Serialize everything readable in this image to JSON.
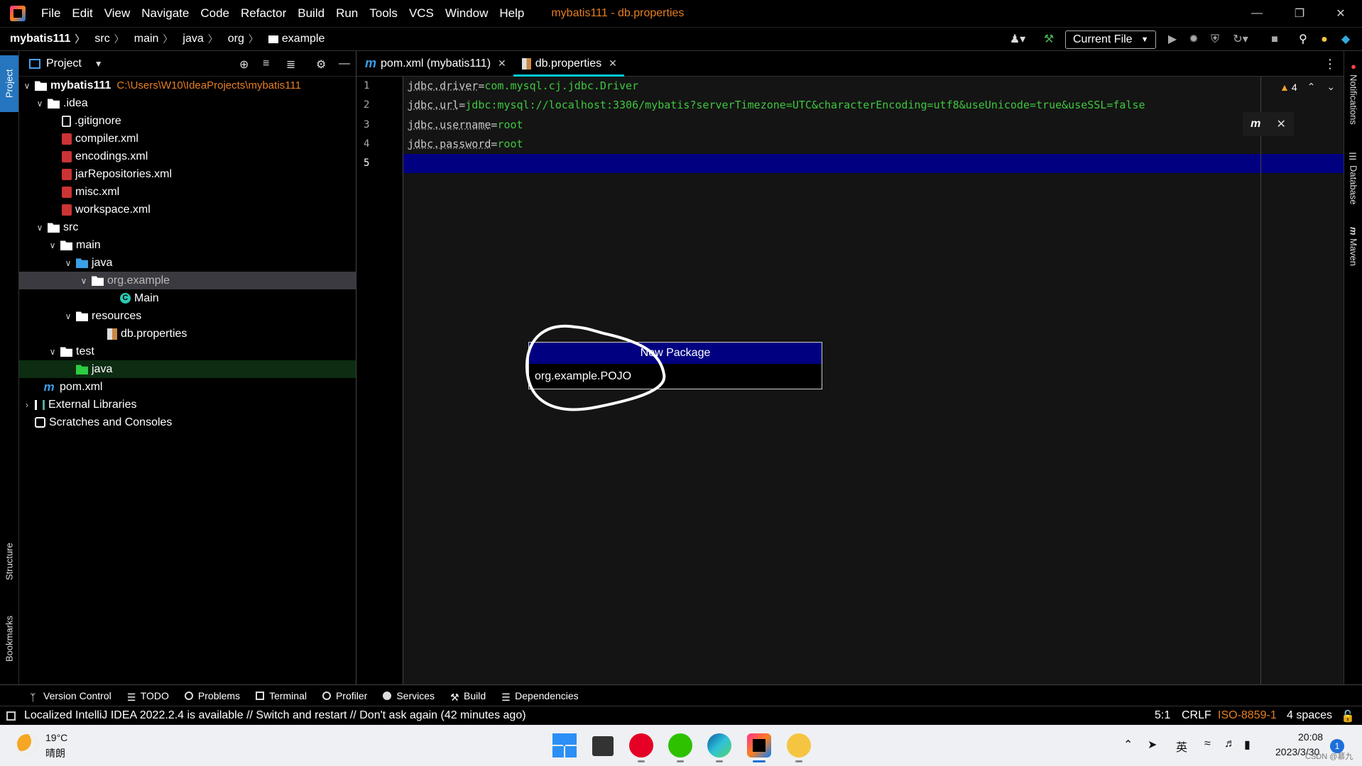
{
  "titlebar": {
    "menu": [
      "File",
      "Edit",
      "View",
      "Navigate",
      "Code",
      "Refactor",
      "Build",
      "Run",
      "Tools",
      "VCS",
      "Window",
      "Help"
    ],
    "window_title": "mybatis111 - db.properties"
  },
  "breadcrumb": [
    "mybatis111",
    "src",
    "main",
    "java",
    "org",
    "example"
  ],
  "run_config": {
    "label": "Current File"
  },
  "project_panel": {
    "title": "Project",
    "tree": [
      {
        "label": "mybatis111",
        "path": "C:\\Users\\W10\\IdeaProjects\\mybatis111"
      },
      {
        "label": ".idea"
      },
      {
        "label": ".gitignore"
      },
      {
        "label": "compiler.xml"
      },
      {
        "label": "encodings.xml"
      },
      {
        "label": "jarRepositories.xml"
      },
      {
        "label": "misc.xml"
      },
      {
        "label": "workspace.xml"
      },
      {
        "label": "src"
      },
      {
        "label": "main"
      },
      {
        "label": "java"
      },
      {
        "label": "org.example"
      },
      {
        "label": "Main"
      },
      {
        "label": "resources"
      },
      {
        "label": "db.properties"
      },
      {
        "label": "test"
      },
      {
        "label": "java"
      },
      {
        "label": "pom.xml"
      },
      {
        "label": "External Libraries"
      },
      {
        "label": "Scratches and Consoles"
      }
    ]
  },
  "left_stripe": {
    "project": "Project",
    "structure": "Structure",
    "bookmarks": "Bookmarks"
  },
  "right_stripe": {
    "notifications": "Notifications",
    "database": "Database",
    "maven": "Maven"
  },
  "editor": {
    "tabs": [
      {
        "label": "pom.xml (mybatis111)"
      },
      {
        "label": "db.properties"
      }
    ],
    "lines": [
      {
        "num": "1",
        "key": "jdbc.driver",
        "value": "com.mysql.cj.jdbc.Driver"
      },
      {
        "num": "2",
        "key": "jdbc.url",
        "value": "jdbc:mysql://localhost:3306/mybatis?serverTimezone=UTC&characterEncoding=utf8&useUnicode=true&useSSL=false"
      },
      {
        "num": "3",
        "key": "jdbc.username",
        "value": "root"
      },
      {
        "num": "4",
        "key": "jdbc.password",
        "value": "root"
      },
      {
        "num": "5",
        "key": "",
        "value": ""
      }
    ],
    "warnings_count": "4"
  },
  "new_package_popup": {
    "title": "New Package",
    "value": "org.example.POJO"
  },
  "bottom_tools": [
    "Version Control",
    "TODO",
    "Problems",
    "Terminal",
    "Profiler",
    "Services",
    "Build",
    "Dependencies"
  ],
  "statusbar": {
    "message": "Localized IntelliJ IDEA 2022.2.4 is available // Switch and restart // Don't ask again (42 minutes ago)",
    "position": "5:1",
    "line_sep": "CRLF",
    "encoding": "ISO-8859-1",
    "indent": "4 spaces"
  },
  "taskbar": {
    "weather_temp": "19°C",
    "weather_desc": "晴朗",
    "ime": "英",
    "time": "20:08",
    "date": "2023/3/30",
    "notifications": "1",
    "watermark": "CSDN @慕九"
  },
  "colors": {
    "accent_tab": "#00c8d2",
    "selection": "#000080",
    "string_value": "#3ec73e",
    "path_hint": "#e67e22"
  }
}
